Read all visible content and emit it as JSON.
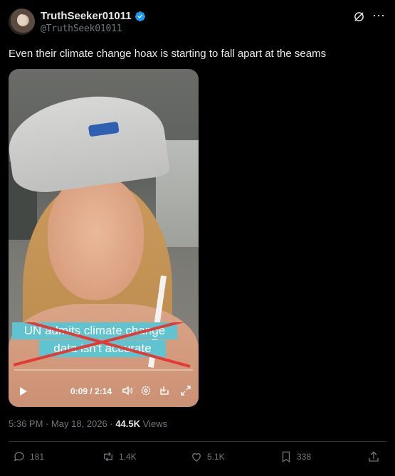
{
  "post": {
    "display_name": "TruthSeeker01011",
    "handle": "@TruthSeek01011",
    "text": "Even their climate change hoax is starting to fall apart at the seams",
    "timestamp": "5:36 PM · May 18, 2026",
    "views_count": "44.5K",
    "views_label": "Views"
  },
  "video": {
    "caption_line1": "UN admits climate change",
    "caption_line2": "data isn't accurate",
    "time": "0:09 / 2:14"
  },
  "actions": {
    "replies": "181",
    "reposts": "1.4K",
    "likes": "5.1K",
    "bookmarks": "338"
  },
  "colors": {
    "background": "#000000",
    "verified": "#1d9bf0",
    "muted": "#71767b",
    "caption_bg": "#5fc4cf",
    "cross": "#e53935"
  }
}
